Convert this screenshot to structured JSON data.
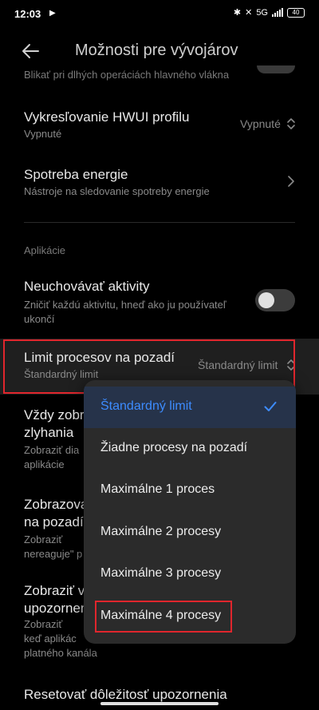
{
  "status": {
    "time": "12:03",
    "network": "5G",
    "battery": "40"
  },
  "header": {
    "title": "Možnosti pre vývojárov"
  },
  "partial_item": {
    "subtitle": "Blikať pri dlhých operáciách hlavného vlákna"
  },
  "items": [
    {
      "title": "Vykresľovanie HWUI profilu",
      "subtitle": "Vypnuté",
      "value": "Vypnuté"
    },
    {
      "title": "Spotreba energie",
      "subtitle": "Nástroje na sledovanie spotreby energie"
    },
    {
      "title": "Neuchovávať aktivity",
      "subtitle_line1": "Zničiť každú aktivitu, hneď ako ju používateľ",
      "subtitle_line2": "ukončí"
    },
    {
      "title": "Limit procesov na pozadí",
      "subtitle": "Štandardný limit",
      "value": "Štandardný limit"
    },
    {
      "title_line1": "Vždy zobr",
      "title_line2": "zlyhania",
      "subtitle_line1": "Zobraziť dia",
      "subtitle_line2": "aplikácie"
    },
    {
      "title_line1": "Zobrazova",
      "title_line2": "na pozadí",
      "subtitle_line1": "Zobraziť",
      "subtitle_line2": "nereaguje\" p"
    },
    {
      "title_line1": "Zobraziť v",
      "title_line2": "upozornen",
      "subtitle_line1": "Zobraziť",
      "subtitle_line2": "keď aplikác",
      "subtitle_line3": "platného kanála"
    },
    {
      "title": "Resetovať dôležitosť upozornenia"
    }
  ],
  "section": {
    "label": "Aplikácie"
  },
  "dropdown": {
    "options": [
      "Štandardný limit",
      "Žiadne procesy na pozadí",
      "Maximálne 1 proces",
      "Maximálne 2 procesy",
      "Maximálne 3 procesy",
      "Maximálne 4 procesy"
    ],
    "selected_index": 0
  },
  "colors": {
    "accent": "#3d8cff",
    "highlight": "#e0262d",
    "background": "#000000"
  },
  "icons": [
    "back-arrow-icon",
    "spinner-icon",
    "chevron-right-icon",
    "check-icon"
  ]
}
